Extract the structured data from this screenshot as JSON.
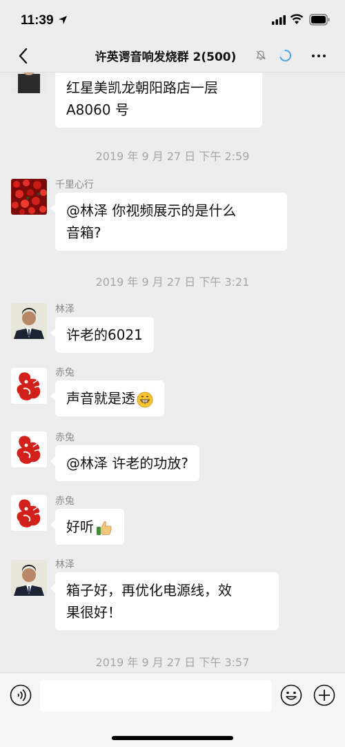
{
  "status_bar": {
    "time": "11:39"
  },
  "nav": {
    "title": "许英谔音响发烧群 2(500)",
    "icons": [
      "back-arrow-icon",
      "mute-bell-icon",
      "loading-icon",
      "more-icon"
    ]
  },
  "chat": {
    "partial_message": {
      "text_line1": "红星美凯龙朝阳路店一层",
      "text_line2": "A8060 号"
    },
    "timestamps": [
      "2019 年 9 月 27 日  下午 2:59",
      "2019 年 9 月 27 日  下午 3:21",
      "2019 年 9 月 27 日  下午 3:57"
    ],
    "messages": [
      {
        "sender": "千里心行",
        "line1": "@林泽  你视频展示的是什么",
        "line2": "音箱?"
      },
      {
        "sender": "林泽",
        "line1": "许老的6021"
      },
      {
        "sender": "赤兔",
        "line1": "声音就是透",
        "emoji": "grinning-face-emoji"
      },
      {
        "sender": "赤兔",
        "line1": "@林泽  许老的功放?"
      },
      {
        "sender": "赤兔",
        "line1": "好听",
        "emoji": "thumbs-up-emoji"
      },
      {
        "sender": "林泽",
        "line1": "箱子好，再优化电源线，效",
        "line2": "果很好！"
      }
    ]
  },
  "input_bar": {
    "placeholder": "",
    "icons": [
      "voice-icon",
      "emoji-icon",
      "plus-icon"
    ]
  },
  "colors": {
    "background": "#ededed",
    "bubble": "#ffffff",
    "timestamp": "#a5a5a5",
    "loading_accent": "#4aa3e8"
  }
}
